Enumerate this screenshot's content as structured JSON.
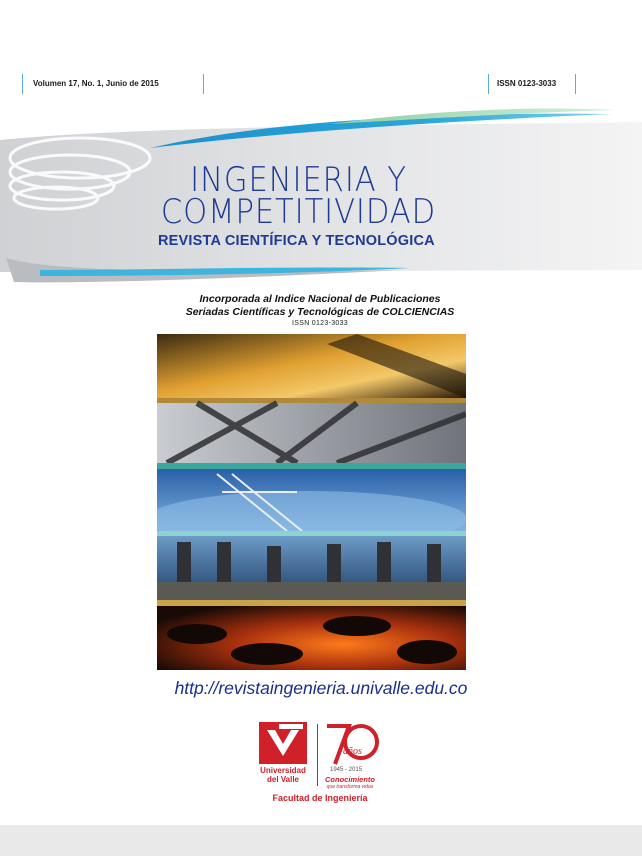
{
  "header": {
    "volume": "Volumen 17, No. 1, Junio de 2015",
    "issn": "ISSN 0123-3033"
  },
  "title": {
    "line1": "INGENIERIA Y",
    "line2": "COMPETITIVIDAD",
    "subtitle": "REVISTA CIENTÍFICA  Y TECNOLÓGICA"
  },
  "indexing": {
    "line1": "Incorporada al Indice Nacional de Publicaciones",
    "line2": "Seriadas Científicas y Tecnológicas de COLCIENCIAS",
    "issn": "ISSN 0123-3033"
  },
  "website": "http://revistaingenieria.univalle.edu.co",
  "logos": {
    "university_line1": "Universidad",
    "university_line2": "del Valle",
    "anniversary_years": "1945 - 2015",
    "anniversary_tagline": "Conocimiento",
    "anniversary_tagline_sub": "que transforma vidas",
    "faculty": "Facultad de Ingeniería"
  },
  "colors": {
    "title_blue": "#1f3a94",
    "accent_cyan": "#2aa6d8",
    "brand_red": "#d0202a",
    "link_blue": "#1a2e8c"
  },
  "icons": [
    "swirl-graphic",
    "universidad-del-valle-logo",
    "70-anos-logo"
  ]
}
